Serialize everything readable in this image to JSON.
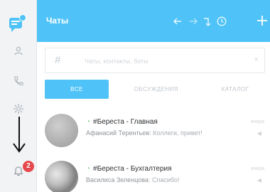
{
  "sidebar": {
    "items": [
      {
        "name": "user-icon"
      },
      {
        "name": "phone-icon"
      },
      {
        "name": "gear-icon"
      },
      {
        "name": "arrow-down-icon"
      },
      {
        "name": "bell-icon",
        "badge": "2"
      }
    ]
  },
  "header": {
    "title": "Чаты",
    "actions": [
      "back-arrow-icon",
      "forward-arrow-icon",
      "rotate-icon",
      "clock-icon",
      "plus-icon"
    ]
  },
  "search": {
    "hash": "#",
    "placeholder": "Чаты, контакты, боты",
    "clear": "×"
  },
  "tabs": [
    {
      "label": "ВСЕ",
      "active": true
    },
    {
      "label": "ОБСУЖДЕНИЯ",
      "active": false
    },
    {
      "label": "КАТАЛОГ",
      "active": false
    }
  ],
  "chats": [
    {
      "title": "#Береста - Главная",
      "sender": "Афанасий Терентьев:",
      "message": "Коллеги, привет!",
      "time": "вчера",
      "status_color": "#8bd08f"
    },
    {
      "title": "#Береста - Бухгалтерия",
      "sender": "Василиса Зеленцова:",
      "message": "Спасибо!",
      "time": "вчера",
      "status_color": "#8bd08f"
    }
  ],
  "colors": {
    "accent": "#4fc3f7",
    "badge": "#e5484d",
    "online": "#8bd08f"
  }
}
